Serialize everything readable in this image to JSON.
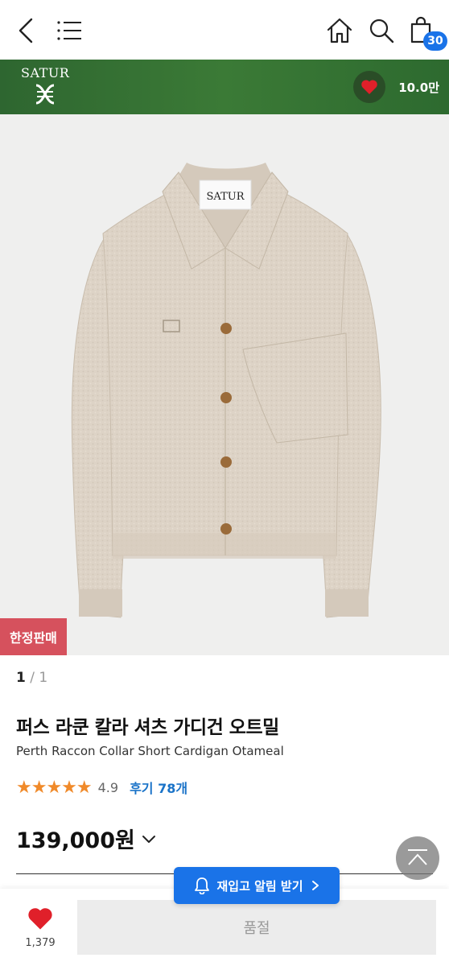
{
  "topbar": {
    "back_icon": "chevron-left-icon",
    "menu_icon": "menu-icon",
    "home_icon": "home-icon",
    "search_icon": "search-icon",
    "cart_icon": "shopping-bag-icon",
    "cart_count": "30"
  },
  "brand": {
    "name": "SATUR",
    "like_count": "10.0만",
    "bar_color": "#336f33"
  },
  "product": {
    "image_label": "SATUR",
    "badge": "한정판매",
    "page_current": "1",
    "page_sep": " / ",
    "page_total": "1",
    "title_ko": "퍼스 라쿤 칼라 셔츠 가디건 오트밀",
    "title_en": "Perth Raccon Collar Short Cardigan Otameal",
    "stars": "★★★★★",
    "rating": "4.9",
    "review_label": "후기 78개",
    "price": "139,000원",
    "star_color": "#f08a2a",
    "badge_color": "#d6515d"
  },
  "restock_button": {
    "label": "재입고 알림 받기"
  },
  "bottom": {
    "wish_count": "1,379",
    "soldout_label": "품절"
  }
}
